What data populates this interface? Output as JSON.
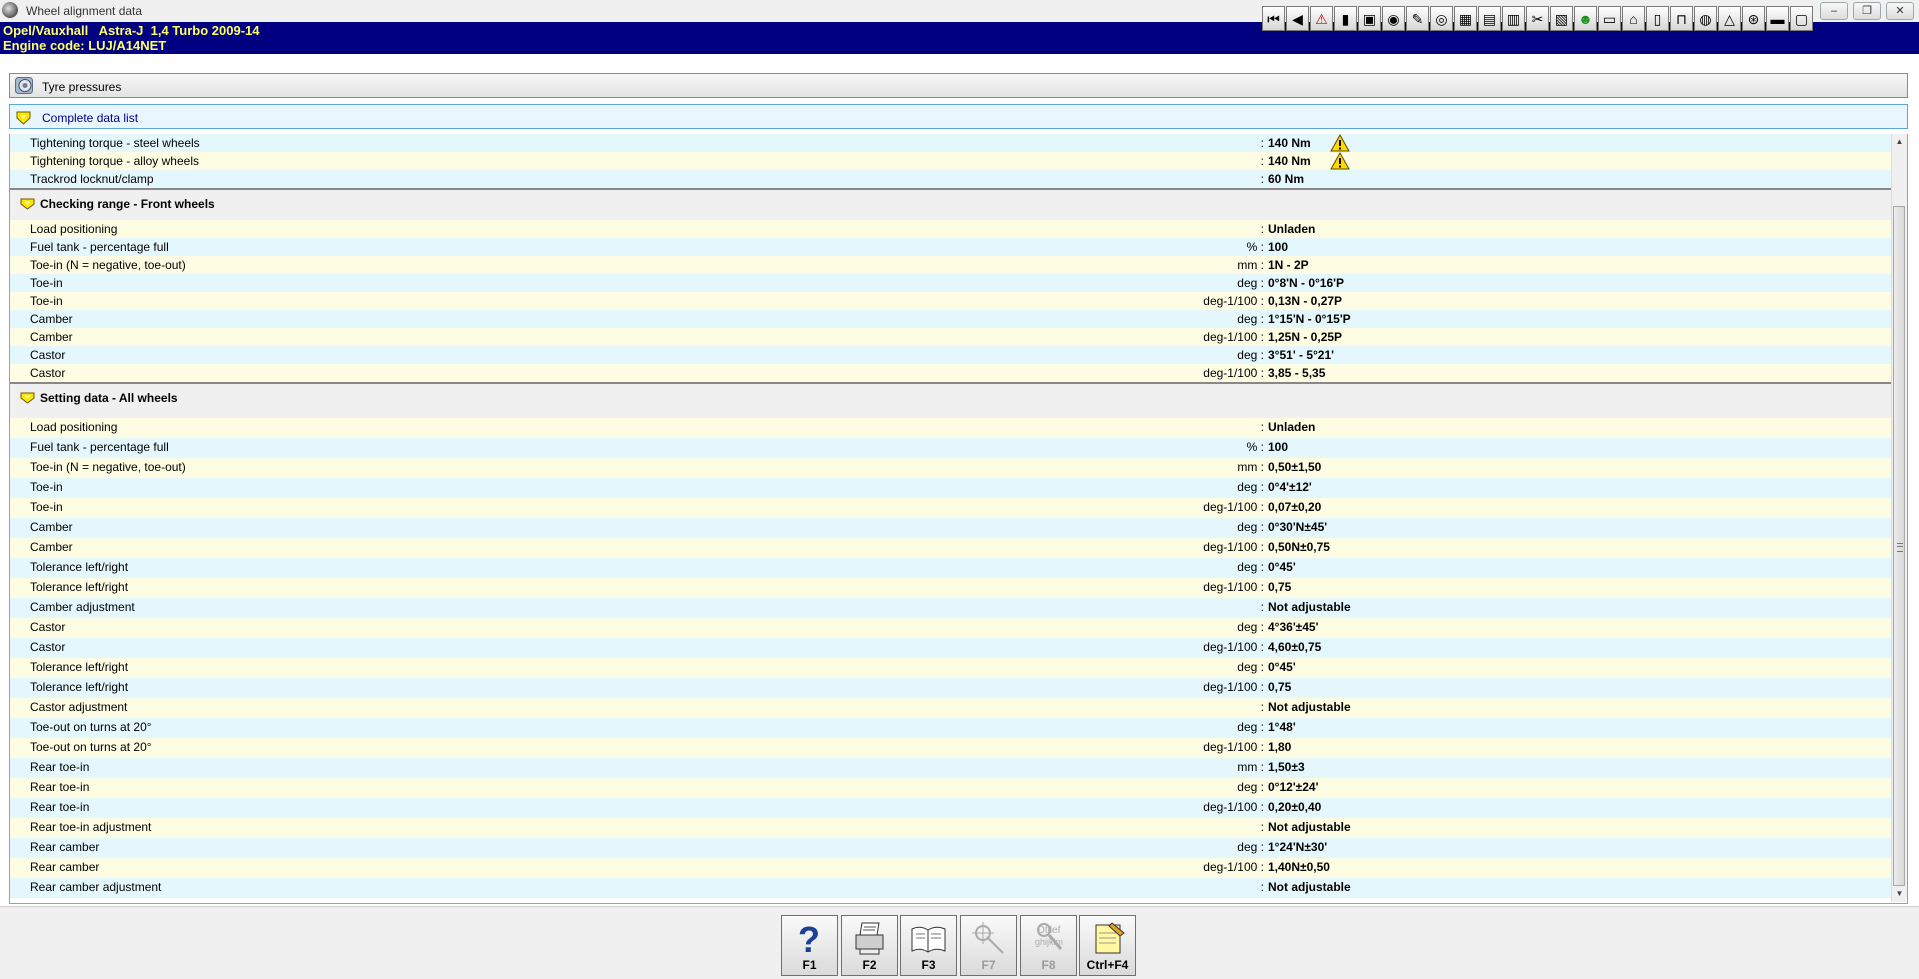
{
  "window": {
    "title": "Wheel alignment data",
    "minimize": "‒",
    "restore": "❐",
    "close": "✕"
  },
  "header": {
    "vehicle": "Opel/Vauxhall   Astra-J  1,4 Turbo 2009-14",
    "engine": "Engine code: LUJ/A14NET"
  },
  "toolbar": [
    {
      "name": "first-icon",
      "glyph": "⏮"
    },
    {
      "name": "back-icon",
      "glyph": "◀"
    },
    {
      "name": "warning-icon",
      "glyph": "⚠"
    },
    {
      "name": "battery-icon",
      "glyph": "▮"
    },
    {
      "name": "monitor-icon",
      "glyph": "▣"
    },
    {
      "name": "fuel-icon",
      "glyph": "◉"
    },
    {
      "name": "key-icon",
      "glyph": "✎"
    },
    {
      "name": "wheel-icon",
      "glyph": "◎"
    },
    {
      "name": "engine-icon",
      "glyph": "▦"
    },
    {
      "name": "chart-icon",
      "glyph": "▤"
    },
    {
      "name": "filter-icon",
      "glyph": "▥"
    },
    {
      "name": "tools-icon",
      "glyph": "✂"
    },
    {
      "name": "book-icon",
      "glyph": "▧"
    },
    {
      "name": "frog-icon",
      "glyph": "☻"
    },
    {
      "name": "car-front-icon",
      "glyph": "▭"
    },
    {
      "name": "car-side-icon",
      "glyph": "⌂"
    },
    {
      "name": "document-icon",
      "glyph": "▯"
    },
    {
      "name": "car-lift-icon",
      "glyph": "⊓"
    },
    {
      "name": "disc-icon",
      "glyph": "◍"
    },
    {
      "name": "airbag-icon",
      "glyph": "△"
    },
    {
      "name": "steering-icon",
      "glyph": "⊛"
    },
    {
      "name": "car-alt-icon",
      "glyph": "▬"
    },
    {
      "name": "note-icon",
      "glyph": "▢"
    }
  ],
  "bars": {
    "tyre_pressures": "Tyre pressures",
    "complete_list": "Complete data list"
  },
  "top_rows": [
    {
      "label": "Tightening torque - steel wheels",
      "unit": ":",
      "value": "140 Nm",
      "warn": true
    },
    {
      "label": "Tightening torque - alloy wheels",
      "unit": ":",
      "value": "140 Nm",
      "warn": true
    },
    {
      "label": "Trackrod locknut/clamp",
      "unit": ":",
      "value": "60 Nm",
      "warn": false
    }
  ],
  "sections": [
    {
      "title": "Checking range - Front wheels",
      "rows": [
        {
          "label": "Load positioning",
          "unit": ":",
          "value": "Unladen"
        },
        {
          "label": "Fuel tank - percentage full",
          "unit": "% :",
          "value": "100"
        },
        {
          "label": "Toe-in (N = negative, toe-out)",
          "unit": "mm :",
          "value": "1N - 2P"
        },
        {
          "label": "Toe-in",
          "unit": "deg :",
          "value": "0°8'N - 0°16'P"
        },
        {
          "label": "Toe-in",
          "unit": "deg-1/100 :",
          "value": "0,13N - 0,27P"
        },
        {
          "label": "Camber",
          "unit": "deg :",
          "value": "1°15'N - 0°15'P"
        },
        {
          "label": "Camber",
          "unit": "deg-1/100 :",
          "value": "1,25N - 0,25P"
        },
        {
          "label": "Castor",
          "unit": "deg :",
          "value": "3°51' - 5°21'"
        },
        {
          "label": "Castor",
          "unit": "deg-1/100 :",
          "value": "3,85 - 5,35"
        }
      ]
    },
    {
      "title": "Setting data - All wheels",
      "rows": [
        {
          "label": "Load positioning",
          "unit": ":",
          "value": "Unladen"
        },
        {
          "label": "Fuel tank - percentage full",
          "unit": "% :",
          "value": "100"
        },
        {
          "label": "Toe-in (N = negative, toe-out)",
          "unit": "mm :",
          "value": "0,50±1,50"
        },
        {
          "label": "Toe-in",
          "unit": "deg :",
          "value": "0°4'±12'"
        },
        {
          "label": "Toe-in",
          "unit": "deg-1/100 :",
          "value": "0,07±0,20"
        },
        {
          "label": "Camber",
          "unit": "deg :",
          "value": "0°30'N±45'"
        },
        {
          "label": "Camber",
          "unit": "deg-1/100 :",
          "value": "0,50N±0,75"
        },
        {
          "label": "Tolerance left/right",
          "unit": "deg :",
          "value": "0°45'"
        },
        {
          "label": "Tolerance left/right",
          "unit": "deg-1/100 :",
          "value": "0,75"
        },
        {
          "label": "Camber adjustment",
          "unit": ":",
          "value": "Not adjustable"
        },
        {
          "label": "Castor",
          "unit": "deg :",
          "value": "4°36'±45'"
        },
        {
          "label": "Castor",
          "unit": "deg-1/100 :",
          "value": "4,60±0,75"
        },
        {
          "label": "Tolerance left/right",
          "unit": "deg :",
          "value": "0°45'"
        },
        {
          "label": "Tolerance left/right",
          "unit": "deg-1/100 :",
          "value": "0,75"
        },
        {
          "label": "Castor adjustment",
          "unit": ":",
          "value": "Not adjustable"
        },
        {
          "label": "Toe-out on turns at 20°",
          "unit": "deg :",
          "value": "1°48'"
        },
        {
          "label": "Toe-out on turns at 20°",
          "unit": "deg-1/100 :",
          "value": "1,80"
        },
        {
          "label": "Rear toe-in",
          "unit": "mm :",
          "value": "1,50±3"
        },
        {
          "label": "Rear toe-in",
          "unit": "deg :",
          "value": "0°12'±24'"
        },
        {
          "label": "Rear toe-in",
          "unit": "deg-1/100 :",
          "value": "0,20±0,40"
        },
        {
          "label": "Rear toe-in adjustment",
          "unit": ":",
          "value": "Not adjustable"
        },
        {
          "label": "Rear camber",
          "unit": "deg :",
          "value": "1°24'N±30'"
        },
        {
          "label": "Rear camber",
          "unit": "deg-1/100 :",
          "value": "1,40N±0,50"
        },
        {
          "label": "Rear camber adjustment",
          "unit": ":",
          "value": "Not adjustable"
        }
      ]
    }
  ],
  "function_buttons": [
    {
      "name": "help-button",
      "label": "F1",
      "icon": "help-icon",
      "enabled": true
    },
    {
      "name": "print-button",
      "label": "F2",
      "icon": "printer-icon",
      "enabled": true
    },
    {
      "name": "manual-button",
      "label": "F3",
      "icon": "open-book-icon",
      "enabled": true
    },
    {
      "name": "f7-button",
      "label": "F7",
      "icon": "tools-icon",
      "enabled": false
    },
    {
      "name": "f8-button",
      "label": "F8",
      "icon": "search-doc-icon",
      "enabled": false
    },
    {
      "name": "notes-button",
      "label": "Ctrl+F4",
      "icon": "notepad-icon",
      "enabled": true
    }
  ],
  "f8_icon_text": [
    "Dtilef",
    "ghijklm"
  ],
  "colors": {
    "header_bg": "#000080",
    "header_text": "#ffff66",
    "row_blue": "#e4f7fd",
    "row_yellow": "#fefde4",
    "warning": "#ffd800"
  }
}
